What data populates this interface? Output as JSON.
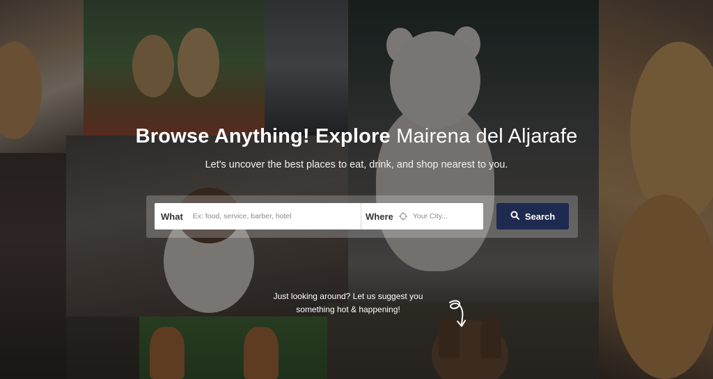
{
  "hero": {
    "title_bold": "Browse Anything! Explore",
    "title_city": "Mairena del Aljarafe",
    "subtitle": "Let's uncover the best places to eat, drink, and shop nearest to you."
  },
  "search": {
    "what_label": "What",
    "what_placeholder": "Ex: food, service, barber, hotel",
    "where_label": "Where",
    "where_placeholder": "Your City...",
    "button_label": "Search",
    "button_icon": "search-icon",
    "locate_icon": "crosshair-icon"
  },
  "suggestion": {
    "line1": "Just looking around? Let us suggest you",
    "line2": "something hot & happening!",
    "arrow_icon": "curly-arrow-down-icon"
  },
  "colors": {
    "button_bg": "#1e2a4f",
    "text_white": "#ffffff"
  }
}
